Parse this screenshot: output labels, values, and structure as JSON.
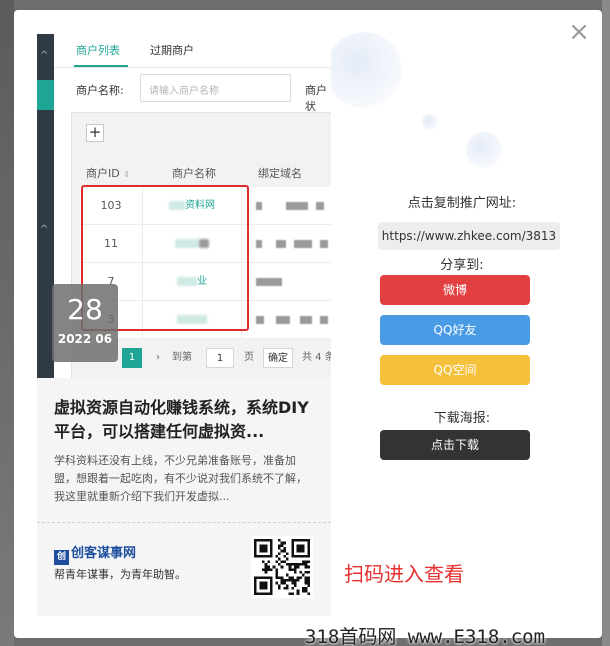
{
  "poster": {
    "screenshot": {
      "tabs": [
        {
          "label": "商户列表"
        },
        {
          "label": "过期商户"
        }
      ],
      "filter_label": "商户名称:",
      "filter_placeholder": "请输入商户名称",
      "filter_label_2": "商户状",
      "add_button": "+",
      "columns": [
        "商户ID",
        "商户名称",
        "绑定域名"
      ],
      "rows": [
        {
          "id": "103",
          "name": "资料网"
        },
        {
          "id": "11",
          "name": ""
        },
        {
          "id": "7",
          "name": "业"
        },
        {
          "id": "3",
          "name": ""
        }
      ],
      "pager": {
        "current_page": "1",
        "goto_prefix": "到第",
        "goto_value": "1",
        "goto_suffix": "页",
        "confirm": "确定",
        "total": "共 4 条"
      }
    },
    "date": {
      "day": "28",
      "year_month": "2022 06"
    },
    "title": "虚拟资源自动化赚钱系统，系统DIY平台，可以搭建任何虚拟资...",
    "description": "学科资料还没有上线，不少兄弟准备账号，准备加盟，想跟着一起吃肉，有不少说对我们系统不了解，我这里就重新介绍下我们开发虚拟...",
    "brand": {
      "logo_text": "创",
      "name": "创客谋事网",
      "slogan": "帮青年谋事，为青年助智。"
    }
  },
  "scan_tip": "扫码进入查看",
  "share": {
    "copy_label": "点击复制推广网址:",
    "url": "https://www.zhkee.com/3813",
    "share_to": "分享到:",
    "weibo": "微博",
    "qq_friend": "QQ好友",
    "qzone": "QQ空间",
    "download_label": "下载海报:",
    "download_button": "点击下载"
  },
  "close_icon": "close-icon",
  "watermark": "318首码网 www.E318.com",
  "colors": {
    "weibo": "#e24040",
    "qq": "#4a9be6",
    "qzone": "#f5c13b",
    "download": "#333333",
    "accent": "#1ea596",
    "highlight_box": "#e02b2b",
    "scan_tip": "#e8312e"
  }
}
